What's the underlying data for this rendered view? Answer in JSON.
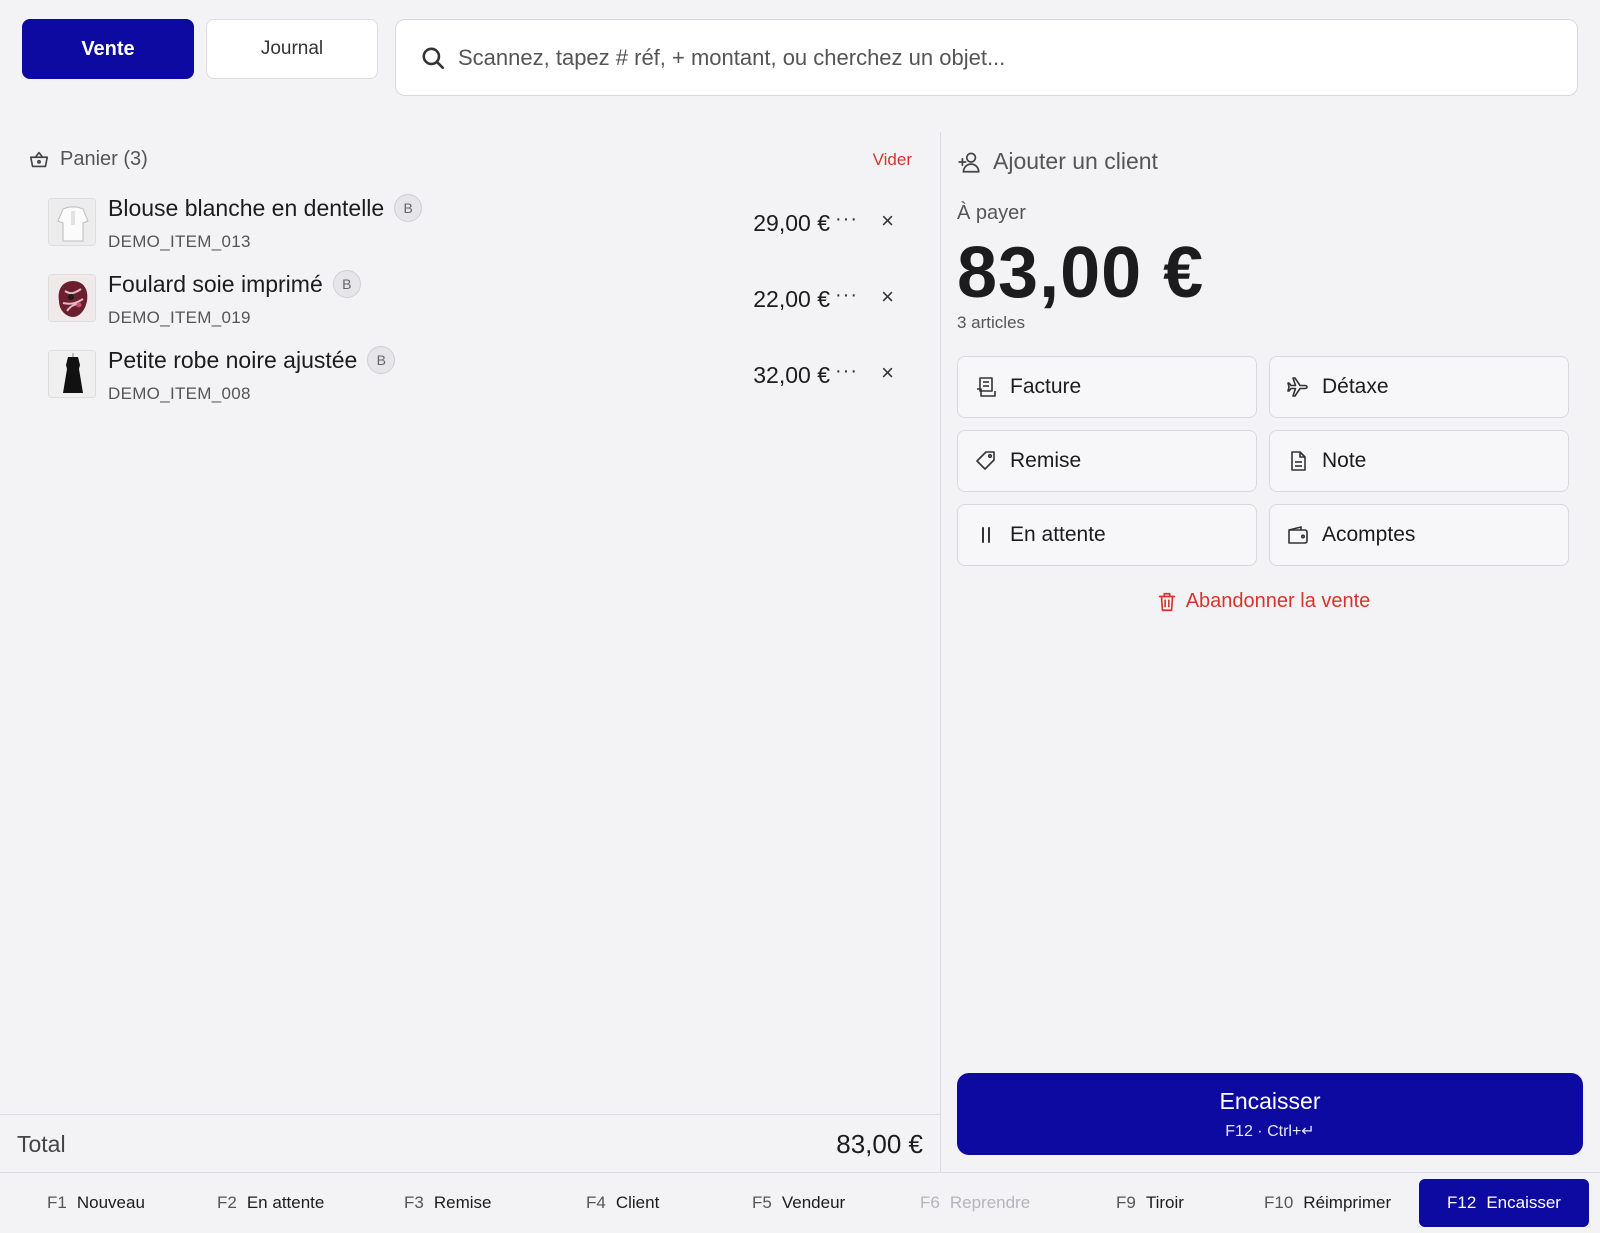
{
  "tabs": {
    "vente": "Vente",
    "journal": "Journal"
  },
  "search": {
    "placeholder": "Scannez, tapez # réf, + montant, ou cherchez un objet..."
  },
  "cart": {
    "title": "Panier (3)",
    "clear_label": "Vider",
    "items": [
      {
        "name": "Blouse blanche en dentelle",
        "badge": "B",
        "ref": "DEMO_ITEM_013",
        "price": "29,00 €",
        "more": "···",
        "remove": "×"
      },
      {
        "name": "Foulard soie imprimé",
        "badge": "B",
        "ref": "DEMO_ITEM_019",
        "price": "22,00 €",
        "more": "···",
        "remove": "×"
      },
      {
        "name": "Petite robe noire ajustée",
        "badge": "B",
        "ref": "DEMO_ITEM_008",
        "price": "32,00 €",
        "more": "···",
        "remove": "×"
      }
    ],
    "total_label": "Total",
    "total_value": "83,00 €"
  },
  "payment": {
    "add_client": "Ajouter un client",
    "to_pay_label": "À payer",
    "amount": "83,00 €",
    "articles": "3 articles",
    "actions": {
      "facture": "Facture",
      "detaxe": "Détaxe",
      "remise": "Remise",
      "note": "Note",
      "en_attente": "En attente",
      "acomptes": "Acomptes"
    },
    "abandon": "Abandonner la vente",
    "checkout": {
      "label": "Encaisser",
      "shortcut": "F12 · Ctrl+↵"
    }
  },
  "fkeys": [
    {
      "key": "F1",
      "label": "Nouveau"
    },
    {
      "key": "F2",
      "label": "En attente"
    },
    {
      "key": "F3",
      "label": "Remise"
    },
    {
      "key": "F4",
      "label": "Client"
    },
    {
      "key": "F5",
      "label": "Vendeur"
    },
    {
      "key": "F6",
      "label": "Reprendre"
    },
    {
      "key": "F9",
      "label": "Tiroir"
    },
    {
      "key": "F10",
      "label": "Réimprimer"
    },
    {
      "key": "F12",
      "label": "Encaisser"
    }
  ],
  "colors": {
    "primary": "#0c0aa0",
    "danger": "#d9342b",
    "background": "#f3f3f6"
  }
}
